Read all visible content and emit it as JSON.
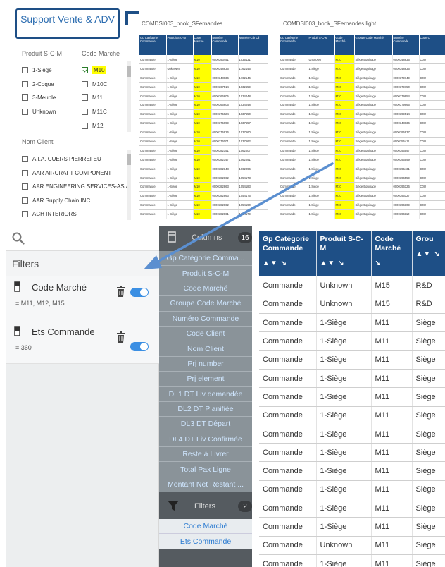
{
  "brand": {
    "title": "Support Vente & ADV"
  },
  "filters_top": {
    "produit_label": "Produit S-C-M",
    "code_marche_label": "Code Marché",
    "produit_options": [
      "1-Siège",
      "2-Coque",
      "3-Meuble",
      "Unknown"
    ],
    "code_options": [
      "M10",
      "M10C",
      "M11",
      "M11C",
      "M12"
    ],
    "nom_client_label": "Nom Client",
    "clients": [
      "A.I.A. CUERS PIERREFEU",
      "AAR AIRCRAFT COMPONENT",
      "AAR ENGINEERING SERVICES-ASIA",
      "AAR Supply Chain INC",
      "ACH INTERIORS"
    ]
  },
  "table1": {
    "title": "COMDSI003_book_SFernandes",
    "headers": [
      "Gp Catégorie Commande",
      "Produit S-C-M",
      "Code Marché",
      "Numéro Commande",
      "Numéro Cdr Cli"
    ],
    "rows": [
      [
        "Commande",
        "1-Siège",
        "M10",
        "0000393451",
        "1035131"
      ],
      [
        "Commande",
        "Unknown",
        "M10",
        "0000348636",
        "1762146"
      ],
      [
        "Commande",
        "1-Siège",
        "M10",
        "0000348636",
        "1762146"
      ],
      [
        "Commande",
        "1-Siège",
        "M10",
        "0000367514",
        "1032659"
      ],
      [
        "Commande",
        "1-Siège",
        "M10",
        "0000366605",
        "1034048"
      ],
      [
        "Commande",
        "1-Siège",
        "M10",
        "0000366606",
        "1034048"
      ],
      [
        "Commande",
        "1-Siège",
        "M10",
        "0000375924",
        "1037650"
      ],
      [
        "Commande",
        "1-Siège",
        "M10",
        "0000375999",
        "1037657"
      ],
      [
        "Commande",
        "1-Siège",
        "M10",
        "0000375926",
        "1037660"
      ],
      [
        "Commande",
        "1-Siège",
        "M10",
        "0000376001",
        "1037662"
      ],
      [
        "Commande",
        "1-Siège",
        "M10",
        "0000382151",
        "1062007"
      ],
      [
        "Commande",
        "1-Siège",
        "M10",
        "0000382147",
        "1062091"
      ],
      [
        "Commande",
        "1-Siège",
        "M10",
        "0000382148",
        "1062096"
      ],
      [
        "Commande",
        "1-Siège",
        "M10",
        "0000382862",
        "1054173"
      ],
      [
        "Commande",
        "1-Siège",
        "M10",
        "0000382863",
        "1054183"
      ],
      [
        "Commande",
        "1-Siège",
        "M10",
        "0000382863",
        "1054176"
      ],
      [
        "Commande",
        "1-Siège",
        "M10",
        "0000382862",
        "1054190"
      ],
      [
        "Commande",
        "1-Siège",
        "M10",
        "0000382861",
        "1054179"
      ]
    ]
  },
  "table2": {
    "title": "COMDSI003_book_SFernandes light",
    "headers": [
      "Gp Catégorie Commande",
      "Produit S-C-M",
      "Code Marché",
      "Groupe Code Marché",
      "Numéro Commande",
      "Code C"
    ],
    "rows": [
      [
        "Commande",
        "Unknown",
        "M10",
        "Siège Equipage",
        "0000348636",
        "C0U"
      ],
      [
        "Commande",
        "1-Siège",
        "M10",
        "Siège Equipage",
        "0000348636",
        "C0U"
      ],
      [
        "Commande",
        "1-Siège",
        "M10",
        "Siège Equipage",
        "0000379749",
        "C0U"
      ],
      [
        "Commande",
        "1-Siège",
        "M10",
        "Siège Equipage",
        "0000379750",
        "C0U"
      ],
      [
        "Commande",
        "1-Siège",
        "M10",
        "Siège Equipage",
        "0000379954",
        "C0U"
      ],
      [
        "Commande",
        "1-Siège",
        "M10",
        "Siège Equipage",
        "0000379966",
        "C0U"
      ],
      [
        "Commande",
        "1-Siège",
        "M10",
        "Siège Equipage",
        "0000399514",
        "C0U"
      ],
      [
        "Commande",
        "1-Siège",
        "M10",
        "Siège Equipage",
        "0000348636",
        "C0U"
      ],
      [
        "Commande",
        "1-Siège",
        "M10",
        "Siège Equipage",
        "0000395937",
        "C0U"
      ],
      [
        "Commande",
        "1-Siège",
        "M10",
        "Siège Equipage",
        "0000355411",
        "C0U"
      ],
      [
        "Commande",
        "1-Siège",
        "M10",
        "Siège Equipage",
        "0000396597",
        "C0U"
      ],
      [
        "Commande",
        "1-Siège",
        "M10",
        "Siège Equipage",
        "0000396599",
        "C0U"
      ],
      [
        "Commande",
        "1-Siège",
        "M10",
        "Siège Equipage",
        "0000395431",
        "C0U"
      ],
      [
        "Commande",
        "1-Siège",
        "M10",
        "Siège Equipage",
        "0000396559",
        "C0U"
      ],
      [
        "Commande",
        "1-Siège",
        "M10",
        "Siège Equipage",
        "0000396126",
        "C0U"
      ],
      [
        "Commande",
        "1-Siège",
        "M10",
        "Siège Equipage",
        "0000396127",
        "C0U"
      ],
      [
        "Commande",
        "1-Siège",
        "M10",
        "Siège Equipage",
        "0000396109",
        "C0U"
      ],
      [
        "Commande",
        "1-Siège",
        "M10",
        "Siège Equipage",
        "0000396110",
        "C0U"
      ]
    ]
  },
  "search": {
    "icon": "search-icon"
  },
  "filters_panel": {
    "title": "Filters",
    "items": [
      {
        "name": "Code Marché",
        "values": "= M11, M12, M15"
      },
      {
        "name": "Ets Commande",
        "values": "= 360"
      }
    ]
  },
  "columns_panel": {
    "label": "Columns",
    "count": "16",
    "items": [
      "Gp Catégorie Comma...",
      "Produit S-C-M",
      "Code Marché",
      "Groupe Code Marché",
      "Numéro Commande",
      "Code Client",
      "Nom Client",
      "Prj number",
      "Prj element",
      "DL1 DT Liv demandée",
      "DL2 DT Planifiée",
      "DL3 DT Départ",
      "DL4 DT Liv Confirmée",
      "Reste à Livrer",
      "Total Pax Ligne",
      "Montant Net Restant ..."
    ],
    "filters_label": "Filters",
    "filters_count": "2",
    "filter_items": [
      "Code Marché",
      "Ets Commande"
    ]
  },
  "main_table": {
    "headers": [
      "Gp Catégorie Commande",
      "Produit S-C-M",
      "Code Marché",
      "Grou"
    ],
    "rows": [
      [
        "Commande",
        "Unknown",
        "M15",
        "R&D"
      ],
      [
        "Commande",
        "Unknown",
        "M15",
        "R&D"
      ],
      [
        "Commande",
        "1-Siège",
        "M11",
        "Siège"
      ],
      [
        "Commande",
        "1-Siège",
        "M11",
        "Siège"
      ],
      [
        "Commande",
        "1-Siège",
        "M11",
        "Siège"
      ],
      [
        "Commande",
        "1-Siège",
        "M11",
        "Siège"
      ],
      [
        "Commande",
        "1-Siège",
        "M11",
        "Siège"
      ],
      [
        "Commande",
        "1-Siège",
        "M11",
        "Siège"
      ],
      [
        "Commande",
        "1-Siège",
        "M11",
        "Siège"
      ],
      [
        "Commande",
        "1-Siège",
        "M11",
        "Siège"
      ],
      [
        "Commande",
        "1-Siège",
        "M11",
        "Siège"
      ],
      [
        "Commande",
        "1-Siège",
        "M11",
        "Siège"
      ],
      [
        "Commande",
        "1-Siège",
        "M11",
        "Siège"
      ],
      [
        "Commande",
        "1-Siège",
        "M11",
        "Siège"
      ],
      [
        "Commande",
        "Unknown",
        "M11",
        "Siège"
      ],
      [
        "Commande",
        "1-Siège",
        "M11",
        "Siège"
      ],
      [
        "Commande",
        "1-Siège",
        "M11",
        "Siège"
      ]
    ]
  },
  "colors": {
    "header_blue": "#1e4f86",
    "highlight": "#ffff00",
    "toggle": "#3b8fe3",
    "link": "#2b7bd1"
  }
}
